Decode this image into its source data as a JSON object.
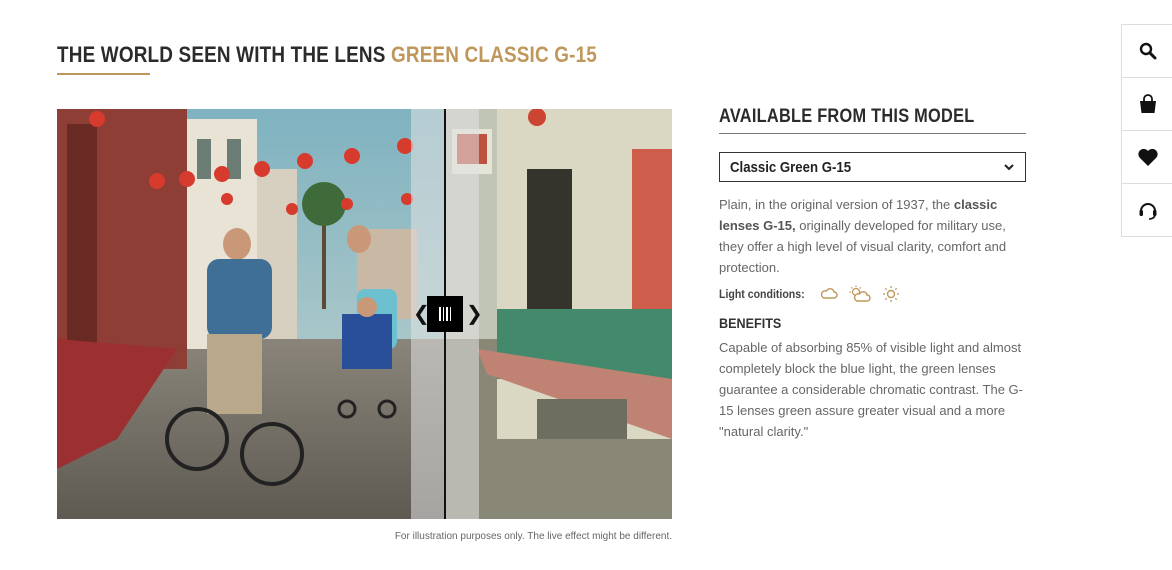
{
  "header": {
    "title_prefix": "THE WORLD SEEN WITH THE LENS",
    "title_accent": "GREEN CLASSIC G-15"
  },
  "slider": {
    "divider_position": 0.63,
    "left_arrow": "❮",
    "right_arrow": "❯",
    "disclaimer": "For illustration purposes only. The live effect might be different."
  },
  "panel": {
    "title": "AVAILABLE FROM THIS MODEL",
    "select_value": "Classic Green G-15",
    "description_part1": "Plain, in the original version of 1937, the ",
    "description_bold": "classic lenses G-15,",
    "description_part2": " originally developed for military use, they offer a high level of visual clarity, comfort and protection.",
    "light_conditions_label": "Light conditions:",
    "light_icons": [
      "cloud-icon",
      "partly-sunny-icon",
      "sun-icon"
    ],
    "benefits_title": "BENEFITS",
    "benefits_text": "Capable of absorbing 85% of visible light and almost completely block the blue light, the green lenses guarantee a considerable chromatic contrast. The G-15 lenses green assure greater visual and a more \"natural clarity.\""
  },
  "side_toolbar": [
    "search-icon",
    "shopping-bag-icon",
    "heart-icon",
    "support-icon"
  ],
  "colors": {
    "accent": "#c0975a",
    "text_dark": "#2b2b2b",
    "text_body": "#666666"
  }
}
